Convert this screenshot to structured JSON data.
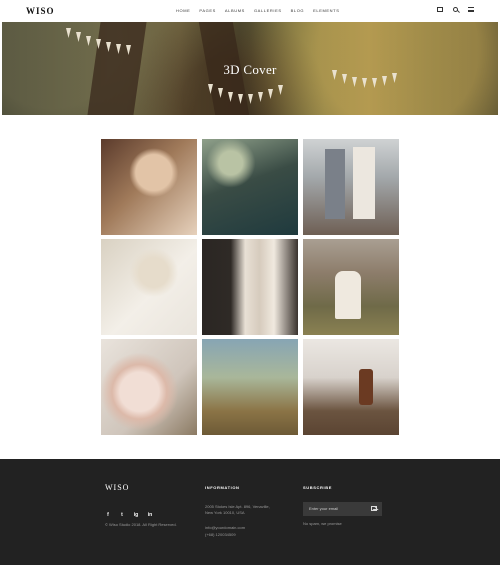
{
  "header": {
    "logo": "WISO",
    "nav": [
      "HOME",
      "PAGES",
      "ALBUMS",
      "GALLERIES",
      "BLOG",
      "ELEMENTS"
    ],
    "icons": [
      "shopping-bag-icon",
      "search-icon",
      "menu-icon"
    ]
  },
  "hero": {
    "title": "3D Cover"
  },
  "gallery": {
    "images": [
      "bride-jewelry-photo",
      "bridesmaids-photo",
      "couple-steps-photo",
      "bride-veil-photo",
      "dresses-rack-photo",
      "couple-field-photo",
      "flowers-rings-photo",
      "hand-grass-photo",
      "shoes-photo"
    ]
  },
  "footer": {
    "logo": "WISO",
    "copyright": "© Wiso Studio 2018. All Right Reserved.",
    "socials": [
      "f",
      "t",
      "ig",
      "in"
    ],
    "information": {
      "heading": "INFORMATION",
      "address_line1": "2005 Stokes Isle Apt. 896, Venaville,",
      "address_line2": "New York 10010, USA",
      "email": "info@yourdomain.com",
      "phone": "(+68) 120034509"
    },
    "subscribe": {
      "heading": "SUBSCRIBE",
      "placeholder": "Enter your email",
      "note": "No spam, we promise"
    }
  }
}
